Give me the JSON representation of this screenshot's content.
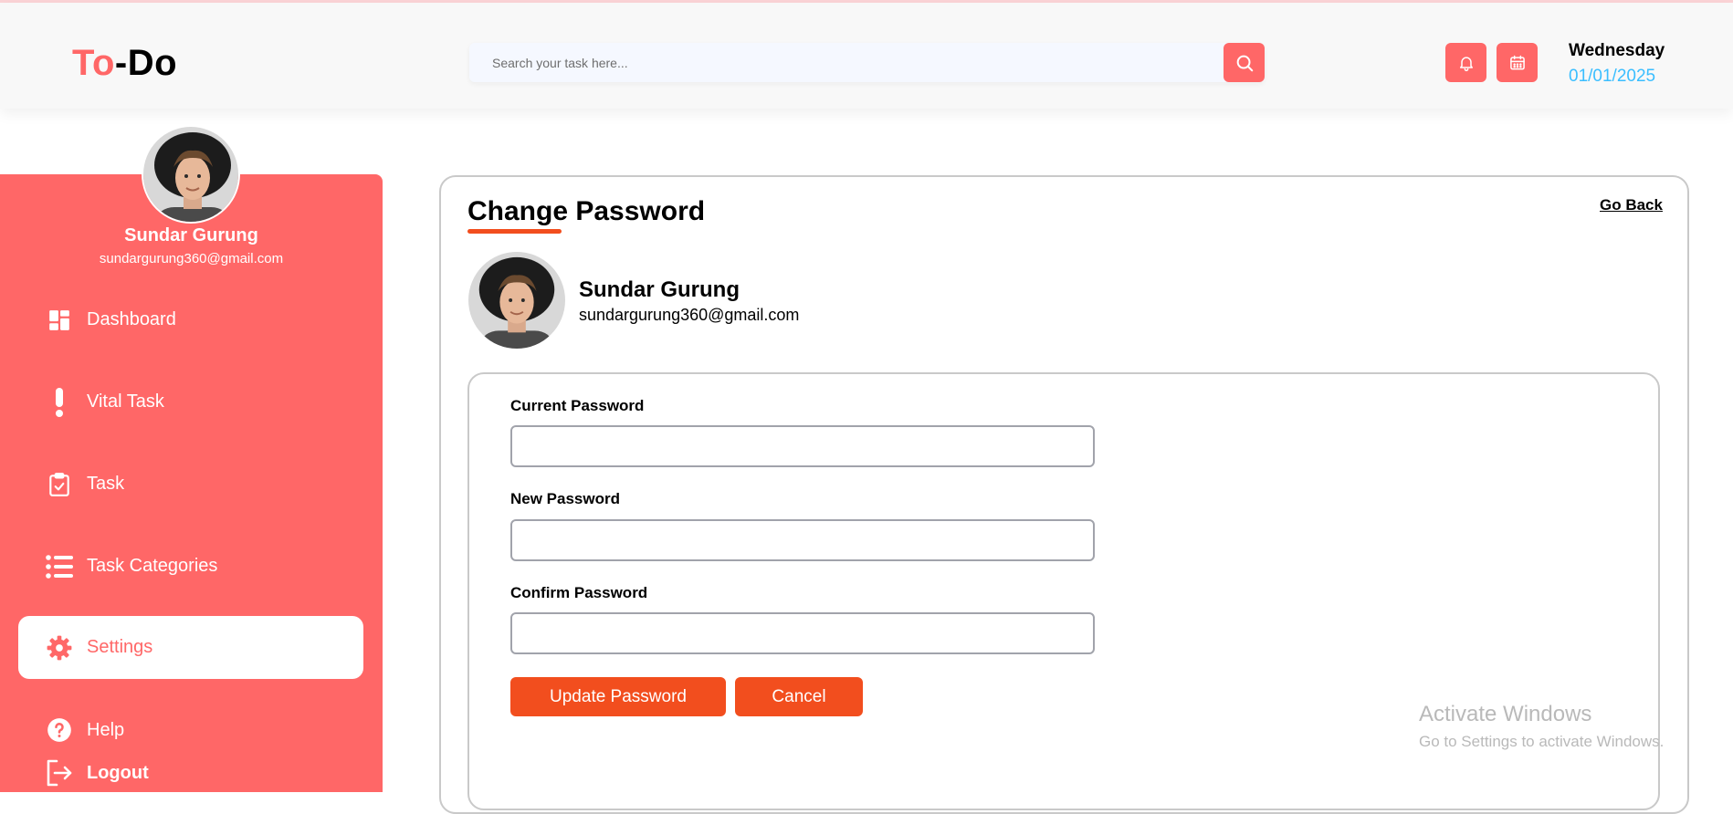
{
  "header": {
    "logo_part1": "To",
    "logo_part2": "-Do",
    "search_placeholder": "Search your task here...",
    "day": "Wednesday",
    "date": "01/01/2025"
  },
  "colors": {
    "brand": "#ff6767",
    "accent": "#f24e1e",
    "date": "#3abeff"
  },
  "sidebar": {
    "user_name": "Sundar Gurung",
    "user_email": "sundargurung360@gmail.com",
    "items": [
      {
        "label": "Dashboard",
        "icon": "dashboard-icon"
      },
      {
        "label": "Vital Task",
        "icon": "exclamation-icon"
      },
      {
        "label": "Task",
        "icon": "clipboard-check-icon"
      },
      {
        "label": "Task Categories",
        "icon": "list-icon"
      },
      {
        "label": "Settings",
        "icon": "gear-icon",
        "active": true
      },
      {
        "label": "Help",
        "icon": "help-icon"
      }
    ],
    "logout_label": "Logout"
  },
  "main": {
    "title": "Change Password",
    "go_back": "Go Back",
    "user_name": "Sundar Gurung",
    "user_email": "sundargurung360@gmail.com",
    "form": {
      "current_label": "Current Password",
      "current_value": "",
      "new_label": "New Password",
      "new_value": "",
      "confirm_label": "Confirm Password",
      "confirm_value": "",
      "update_button": "Update Password",
      "cancel_button": "Cancel"
    }
  },
  "watermark": {
    "line1": "Activate Windows",
    "line2": "Go to Settings to activate Windows."
  }
}
